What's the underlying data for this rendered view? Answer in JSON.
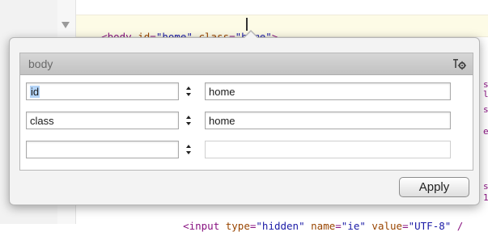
{
  "editor": {
    "top_line": {
      "open": "<",
      "tag": "body",
      "attr1": " id",
      "eq1": "=",
      "val1": "\"home\"",
      "attr2": " class",
      "eq2": "=",
      "val2": "\"home\"",
      "close": ">"
    },
    "bottom_line": {
      "open": "<",
      "tag": "input",
      "attr1": " type",
      "eq1": "=",
      "val1": "\"hidden\"",
      "attr2": " name",
      "eq2": "=",
      "val2": "\"ie\"",
      "attr3": " value",
      "eq3": "=",
      "val3": "\"UTF-8\"",
      "tail": " /"
    },
    "side_fragments": [
      "s",
      "l",
      "s",
      "e",
      "s",
      "1"
    ]
  },
  "popover": {
    "title": "body",
    "settings_icon": "attributes-settings-icon",
    "attributes": [
      {
        "name": "id",
        "value": "home",
        "name_selected": true
      },
      {
        "name": "class",
        "value": "home",
        "name_selected": false
      },
      {
        "name": "",
        "value": "",
        "name_selected": false
      }
    ],
    "apply_label": "Apply"
  }
}
